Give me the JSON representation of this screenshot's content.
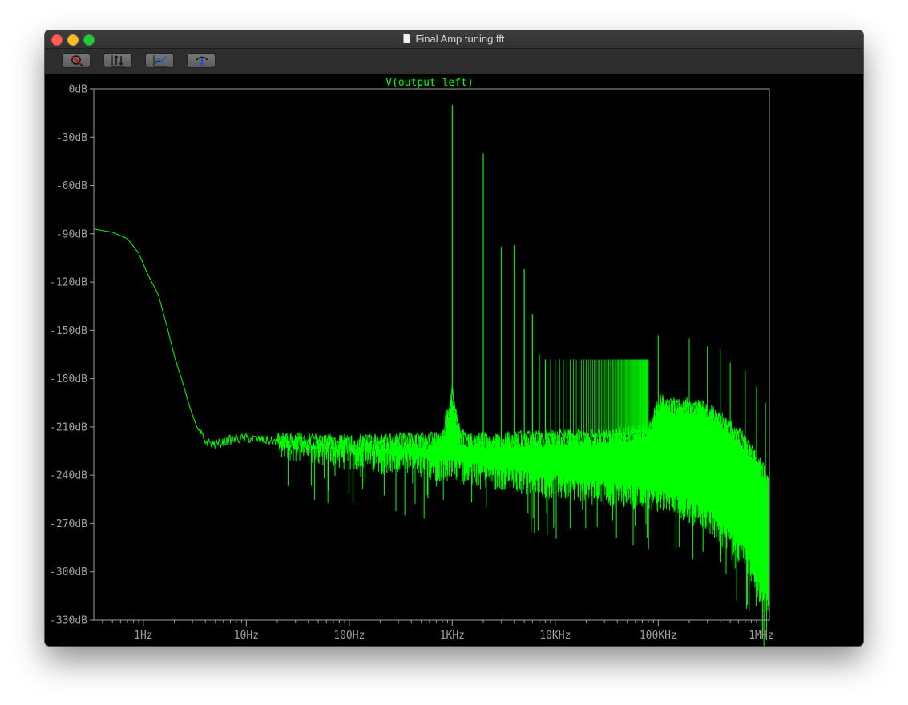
{
  "window": {
    "title": "Final Amp tuning.fft"
  },
  "toolbar": {
    "buttons": [
      {
        "name": "zoom-cancel-button",
        "icon": "zoom-cancel-icon"
      },
      {
        "name": "autorange-y-button",
        "icon": "autorange-y-icon"
      },
      {
        "name": "autorange-x-button",
        "icon": "autorange-x-icon"
      },
      {
        "name": "pick-visible-traces-button",
        "icon": "pick-traces-icon"
      }
    ]
  },
  "chart_data": {
    "type": "line",
    "title": "V(output-left)",
    "xlabel": "",
    "ylabel": "",
    "x_scale": "log",
    "xlim": [
      0.33,
      1200000
    ],
    "ylim": [
      -330,
      0
    ],
    "xticks": [
      {
        "value": 1,
        "label": "1Hz"
      },
      {
        "value": 10,
        "label": "10Hz"
      },
      {
        "value": 100,
        "label": "100Hz"
      },
      {
        "value": 1000,
        "label": "1KHz"
      },
      {
        "value": 10000,
        "label": "10KHz"
      },
      {
        "value": 100000,
        "label": "100KHz"
      },
      {
        "value": 1000000,
        "label": "1MHz"
      }
    ],
    "yticks": [
      {
        "value": 0,
        "label": "0dB"
      },
      {
        "value": -30,
        "label": "-30dB"
      },
      {
        "value": -60,
        "label": "-60dB"
      },
      {
        "value": -90,
        "label": "-90dB"
      },
      {
        "value": -120,
        "label": "-120dB"
      },
      {
        "value": -150,
        "label": "-150dB"
      },
      {
        "value": -180,
        "label": "-180dB"
      },
      {
        "value": -210,
        "label": "-210dB"
      },
      {
        "value": -240,
        "label": "-240dB"
      },
      {
        "value": -270,
        "label": "-270dB"
      },
      {
        "value": -300,
        "label": "-300dB"
      },
      {
        "value": -330,
        "label": "-330dB"
      }
    ],
    "grid": false,
    "colors": {
      "trace": "#00ff00",
      "axes": "#a0a0a0",
      "title": "#00ff00",
      "background": "#000000"
    },
    "series": [
      {
        "name": "V(output-left)",
        "envelope": [
          [
            0.33,
            -87
          ],
          [
            0.5,
            -89
          ],
          [
            0.7,
            -93
          ],
          [
            0.9,
            -102
          ],
          [
            1.1,
            -115
          ],
          [
            1.4,
            -128
          ],
          [
            1.7,
            -148
          ],
          [
            2.0,
            -166
          ],
          [
            2.4,
            -182
          ],
          [
            2.8,
            -197
          ],
          [
            3.3,
            -210
          ],
          [
            4.0,
            -219
          ],
          [
            5.0,
            -221
          ],
          [
            7.0,
            -218
          ],
          [
            10,
            -217
          ],
          [
            20,
            -219
          ],
          [
            50,
            -220
          ],
          [
            100,
            -220
          ],
          [
            300,
            -219
          ],
          [
            600,
            -219
          ],
          [
            800,
            -216
          ],
          [
            1000,
            -190
          ],
          [
            1200,
            -216
          ],
          [
            1500,
            -219
          ],
          [
            5000,
            -218
          ],
          [
            20000,
            -217
          ],
          [
            50000,
            -215
          ],
          [
            80000,
            -212
          ],
          [
            100000,
            -195
          ],
          [
            150000,
            -198
          ],
          [
            250000,
            -197
          ],
          [
            400000,
            -205
          ],
          [
            600000,
            -215
          ],
          [
            900000,
            -230
          ],
          [
            1200000,
            -245
          ]
        ],
        "noise_floor": [
          [
            10,
            -222
          ],
          [
            100,
            -232
          ],
          [
            1000,
            -240
          ],
          [
            10000,
            -250
          ],
          [
            100000,
            -258
          ],
          [
            300000,
            -270
          ],
          [
            700000,
            -295
          ],
          [
            1200000,
            -328
          ]
        ],
        "harmonics": [
          {
            "freq": 1000,
            "db": -10
          },
          {
            "freq": 2000,
            "db": -40
          },
          {
            "freq": 3000,
            "db": -98
          },
          {
            "freq": 4000,
            "db": -97
          },
          {
            "freq": 5000,
            "db": -112
          },
          {
            "freq": 6000,
            "db": -140
          },
          {
            "freq": 7000,
            "db": -165
          },
          {
            "freq": 8000,
            "db": -168
          }
        ],
        "spur_plateau_db": -168,
        "spurs": [
          {
            "freq": 100000,
            "db": -153
          },
          {
            "freq": 200000,
            "db": -155
          },
          {
            "freq": 300000,
            "db": -160
          },
          {
            "freq": 400000,
            "db": -162
          },
          {
            "freq": 500000,
            "db": -170
          },
          {
            "freq": 700000,
            "db": -175
          },
          {
            "freq": 900000,
            "db": -185
          },
          {
            "freq": 1100000,
            "db": -195
          }
        ]
      }
    ]
  }
}
